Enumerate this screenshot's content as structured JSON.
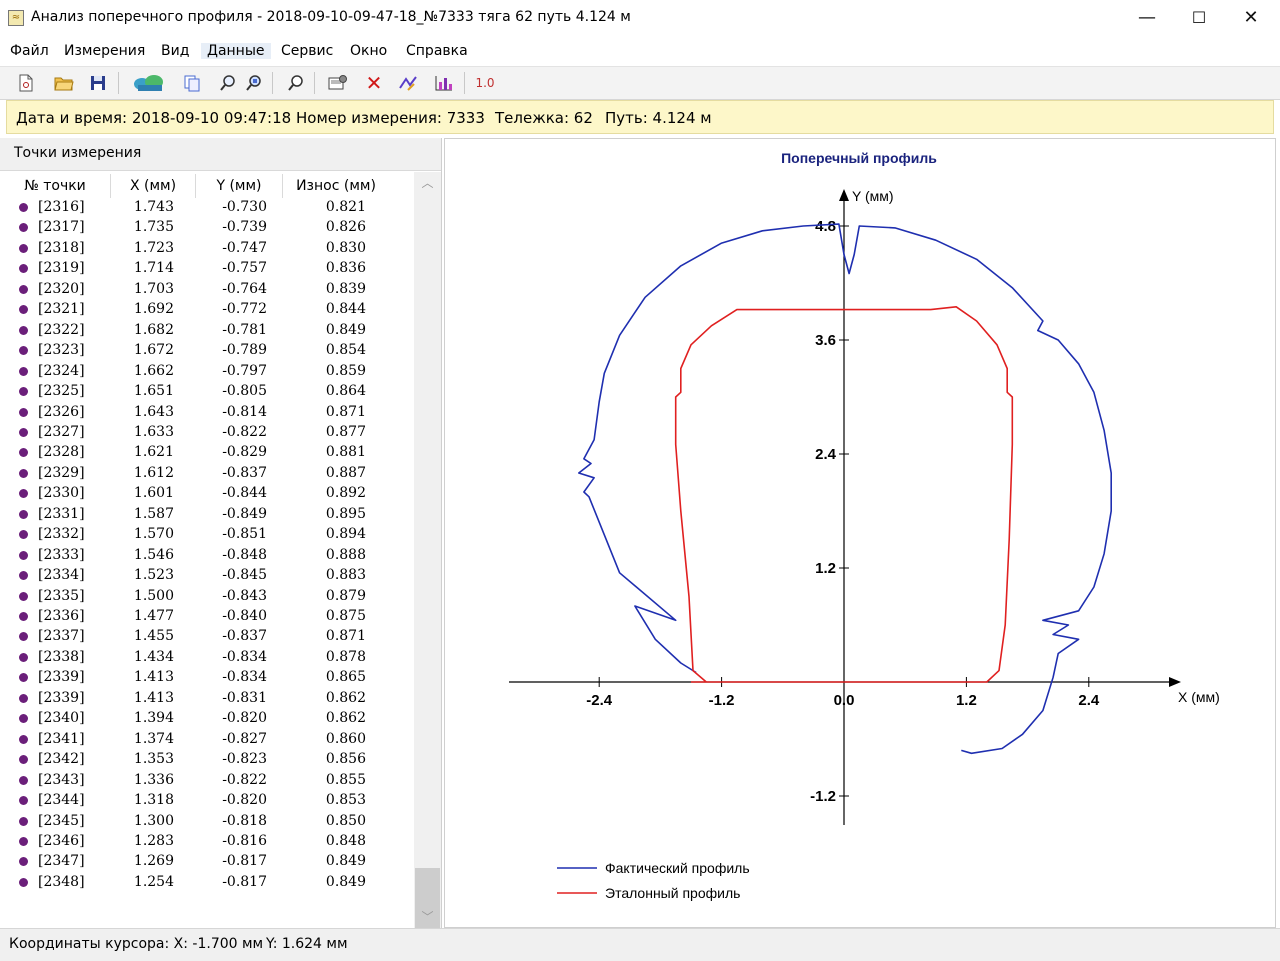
{
  "window": {
    "title": "Анализ поперечного профиля - 2018-09-10-09-47-18_№7333 тяга 62 путь 4.124 м",
    "minimize": "—",
    "maximize": "☐",
    "close": "✕"
  },
  "menu": [
    "Файл",
    "Измерения",
    "Вид",
    "Данные",
    "Сервис",
    "Окно",
    "Справка"
  ],
  "menu_active": "Данные",
  "toolbar": {
    "icons": [
      "new-document-icon",
      "open-folder-icon",
      "save-icon",
      "cloud-data-icon",
      "copy-icon",
      "zoom-icon",
      "zoom-fit-icon",
      "search-icon",
      "settings-icon",
      "delete-icon",
      "edit-curve-icon",
      "chart-icon",
      "scale-icon"
    ],
    "scale_label": "1.0"
  },
  "info": {
    "datetime_label": "Дата и время: 2018-09-10 09:47:18",
    "measurement_label": "Номер измерения: 7333",
    "cart_label": "Тележка: 62",
    "path_label": "Путь: 4.124 м"
  },
  "points_panel": {
    "title": "Точки измерения",
    "columns": [
      "№ точки",
      "X (мм)",
      "Y (мм)",
      "Износ (мм)"
    ],
    "rows": [
      {
        "id": "[2316]",
        "x": "1.743",
        "y": "-0.730",
        "wear": "0.821"
      },
      {
        "id": "[2317]",
        "x": "1.735",
        "y": "-0.739",
        "wear": "0.826"
      },
      {
        "id": "[2318]",
        "x": "1.723",
        "y": "-0.747",
        "wear": "0.830"
      },
      {
        "id": "[2319]",
        "x": "1.714",
        "y": "-0.757",
        "wear": "0.836"
      },
      {
        "id": "[2320]",
        "x": "1.703",
        "y": "-0.764",
        "wear": "0.839"
      },
      {
        "id": "[2321]",
        "x": "1.692",
        "y": "-0.772",
        "wear": "0.844"
      },
      {
        "id": "[2322]",
        "x": "1.682",
        "y": "-0.781",
        "wear": "0.849"
      },
      {
        "id": "[2323]",
        "x": "1.672",
        "y": "-0.789",
        "wear": "0.854"
      },
      {
        "id": "[2324]",
        "x": "1.662",
        "y": "-0.797",
        "wear": "0.859"
      },
      {
        "id": "[2325]",
        "x": "1.651",
        "y": "-0.805",
        "wear": "0.864"
      },
      {
        "id": "[2326]",
        "x": "1.643",
        "y": "-0.814",
        "wear": "0.871"
      },
      {
        "id": "[2327]",
        "x": "1.633",
        "y": "-0.822",
        "wear": "0.877"
      },
      {
        "id": "[2328]",
        "x": "1.621",
        "y": "-0.829",
        "wear": "0.881"
      },
      {
        "id": "[2329]",
        "x": "1.612",
        "y": "-0.837",
        "wear": "0.887"
      },
      {
        "id": "[2330]",
        "x": "1.601",
        "y": "-0.844",
        "wear": "0.892"
      },
      {
        "id": "[2331]",
        "x": "1.587",
        "y": "-0.849",
        "wear": "0.895"
      },
      {
        "id": "[2332]",
        "x": "1.570",
        "y": "-0.851",
        "wear": "0.894"
      },
      {
        "id": "[2333]",
        "x": "1.546",
        "y": "-0.848",
        "wear": "0.888"
      },
      {
        "id": "[2334]",
        "x": "1.523",
        "y": "-0.845",
        "wear": "0.883"
      },
      {
        "id": "[2335]",
        "x": "1.500",
        "y": "-0.843",
        "wear": "0.879"
      },
      {
        "id": "[2336]",
        "x": "1.477",
        "y": "-0.840",
        "wear": "0.875"
      },
      {
        "id": "[2337]",
        "x": "1.455",
        "y": "-0.837",
        "wear": "0.871"
      },
      {
        "id": "[2338]",
        "x": "1.434",
        "y": "-0.834",
        "wear": "0.878"
      },
      {
        "id": "[2339]",
        "x": "1.413",
        "y": "-0.834",
        "wear": "0.865"
      },
      {
        "id": "[2339]",
        "x": "1.413",
        "y": "-0.831",
        "wear": "0.862"
      },
      {
        "id": "[2340]",
        "x": "1.394",
        "y": "-0.820",
        "wear": "0.862"
      },
      {
        "id": "[2341]",
        "x": "1.374",
        "y": "-0.827",
        "wear": "0.860"
      },
      {
        "id": "[2342]",
        "x": "1.353",
        "y": "-0.823",
        "wear": "0.856"
      },
      {
        "id": "[2343]",
        "x": "1.336",
        "y": "-0.822",
        "wear": "0.855"
      },
      {
        "id": "[2344]",
        "x": "1.318",
        "y": "-0.820",
        "wear": "0.853"
      },
      {
        "id": "[2345]",
        "x": "1.300",
        "y": "-0.818",
        "wear": "0.850"
      },
      {
        "id": "[2346]",
        "x": "1.283",
        "y": "-0.816",
        "wear": "0.848"
      },
      {
        "id": "[2347]",
        "x": "1.269",
        "y": "-0.817",
        "wear": "0.849"
      },
      {
        "id": "[2348]",
        "x": "1.254",
        "y": "-0.817",
        "wear": "0.849"
      }
    ]
  },
  "status": {
    "cursor_x": "Координаты курсора: X: -1.700 мм",
    "cursor_y": "Y: 1.624 мм"
  },
  "colors": {
    "actual": "#1f2fb0",
    "reference": "#e02020",
    "info_bg": "#fdf7c9",
    "point_dot": "#6b1f7a"
  },
  "chart_data": {
    "type": "line",
    "title": "Поперечный профиль",
    "xlabel": "X (мм)",
    "ylabel": "Y (мм)",
    "xlim": [
      -3.3,
      3.3
    ],
    "ylim": [
      -1.4,
      4.9
    ],
    "x_ticks": [
      "-2.4",
      "-1.2",
      "0.0",
      "1.2",
      "2.4"
    ],
    "x_tick_values": [
      -2.4,
      -1.2,
      0.0,
      1.2,
      2.4
    ],
    "y_ticks": [
      "4.8",
      "3.6",
      "2.4",
      "1.2",
      "-1.2"
    ],
    "y_tick_values": [
      4.8,
      3.6,
      2.4,
      1.2,
      -1.2
    ],
    "legend_position": "bottom-left",
    "series": [
      {
        "name": "Фактический профиль",
        "color": "#1f2fb0",
        "points": [
          [
            -1.45,
            0.1
          ],
          [
            -1.6,
            0.2
          ],
          [
            -1.85,
            0.45
          ],
          [
            -2.05,
            0.8
          ],
          [
            -1.65,
            0.65
          ],
          [
            -2.2,
            1.15
          ],
          [
            -2.35,
            1.55
          ],
          [
            -2.5,
            1.95
          ],
          [
            -2.55,
            2.0
          ],
          [
            -2.45,
            2.15
          ],
          [
            -2.6,
            2.2
          ],
          [
            -2.48,
            2.3
          ],
          [
            -2.55,
            2.35
          ],
          [
            -2.45,
            2.55
          ],
          [
            -2.4,
            2.95
          ],
          [
            -2.35,
            3.25
          ],
          [
            -2.2,
            3.65
          ],
          [
            -1.95,
            4.05
          ],
          [
            -1.6,
            4.38
          ],
          [
            -1.2,
            4.62
          ],
          [
            -0.8,
            4.75
          ],
          [
            -0.4,
            4.8
          ],
          [
            -0.05,
            4.82
          ],
          [
            0.0,
            4.5
          ],
          [
            0.05,
            4.3
          ],
          [
            0.1,
            4.5
          ],
          [
            0.15,
            4.8
          ],
          [
            0.5,
            4.78
          ],
          [
            0.9,
            4.65
          ],
          [
            1.3,
            4.45
          ],
          [
            1.65,
            4.15
          ],
          [
            1.95,
            3.8
          ],
          [
            1.9,
            3.7
          ],
          [
            2.1,
            3.6
          ],
          [
            2.3,
            3.35
          ],
          [
            2.45,
            3.05
          ],
          [
            2.55,
            2.65
          ],
          [
            2.62,
            2.2
          ],
          [
            2.62,
            1.8
          ],
          [
            2.55,
            1.35
          ],
          [
            2.45,
            1.0
          ],
          [
            2.3,
            0.75
          ],
          [
            1.95,
            0.65
          ],
          [
            2.2,
            0.6
          ],
          [
            2.05,
            0.5
          ],
          [
            2.3,
            0.45
          ],
          [
            2.1,
            0.3
          ],
          [
            2.05,
            0.05
          ],
          [
            1.95,
            -0.3
          ],
          [
            1.75,
            -0.55
          ],
          [
            1.55,
            -0.7
          ],
          [
            1.25,
            -0.75
          ],
          [
            1.15,
            -0.72
          ]
        ]
      },
      {
        "name": "Эталонный профиль",
        "color": "#e02020",
        "points": [
          [
            -1.5,
            0.0
          ],
          [
            -1.35,
            0.0
          ],
          [
            -1.48,
            0.12
          ],
          [
            -1.52,
            0.9
          ],
          [
            -1.6,
            1.8
          ],
          [
            -1.65,
            2.5
          ],
          [
            -1.65,
            3.0
          ],
          [
            -1.6,
            3.05
          ],
          [
            -1.6,
            3.3
          ],
          [
            -1.5,
            3.55
          ],
          [
            -1.3,
            3.75
          ],
          [
            -1.05,
            3.92
          ],
          [
            -0.5,
            3.92
          ],
          [
            0.0,
            3.92
          ],
          [
            0.85,
            3.92
          ],
          [
            1.1,
            3.95
          ],
          [
            1.3,
            3.8
          ],
          [
            1.5,
            3.55
          ],
          [
            1.6,
            3.3
          ],
          [
            1.6,
            3.05
          ],
          [
            1.65,
            3.0
          ],
          [
            1.65,
            2.5
          ],
          [
            1.62,
            1.5
          ],
          [
            1.58,
            0.6
          ],
          [
            1.52,
            0.12
          ],
          [
            1.4,
            0.0
          ],
          [
            0.0,
            0.0
          ],
          [
            -1.5,
            0.0
          ]
        ]
      }
    ]
  }
}
